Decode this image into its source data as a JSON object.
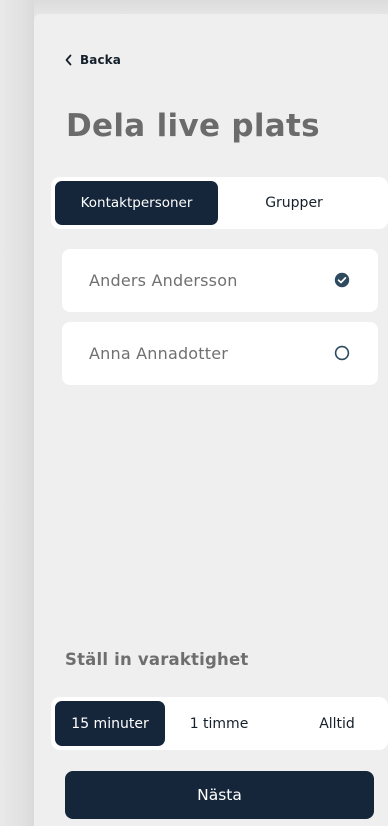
{
  "header": {
    "back_label": "Backa",
    "title": "Dela live plats"
  },
  "tabs": {
    "items": [
      {
        "label": "Kontaktpersoner",
        "active": true
      },
      {
        "label": "Grupper",
        "active": false
      }
    ]
  },
  "contacts": [
    {
      "name": "Anders Andersson",
      "selected": true,
      "icon": "check-circle-filled-icon"
    },
    {
      "name": "Anna Annadotter",
      "selected": false,
      "icon": "circle-outline-icon"
    }
  ],
  "duration": {
    "label": "Ställ in varaktighet",
    "options": [
      {
        "label": "15 minuter",
        "active": true
      },
      {
        "label": "1 timme",
        "active": false
      },
      {
        "label": "Alltid",
        "active": false
      }
    ]
  },
  "footer": {
    "next_label": "Nästa"
  },
  "colors": {
    "primary": "#15253a",
    "accent": "#2d4a5e",
    "background": "#efefef",
    "card": "#ffffff",
    "muted_text": "#6b6b6b"
  }
}
